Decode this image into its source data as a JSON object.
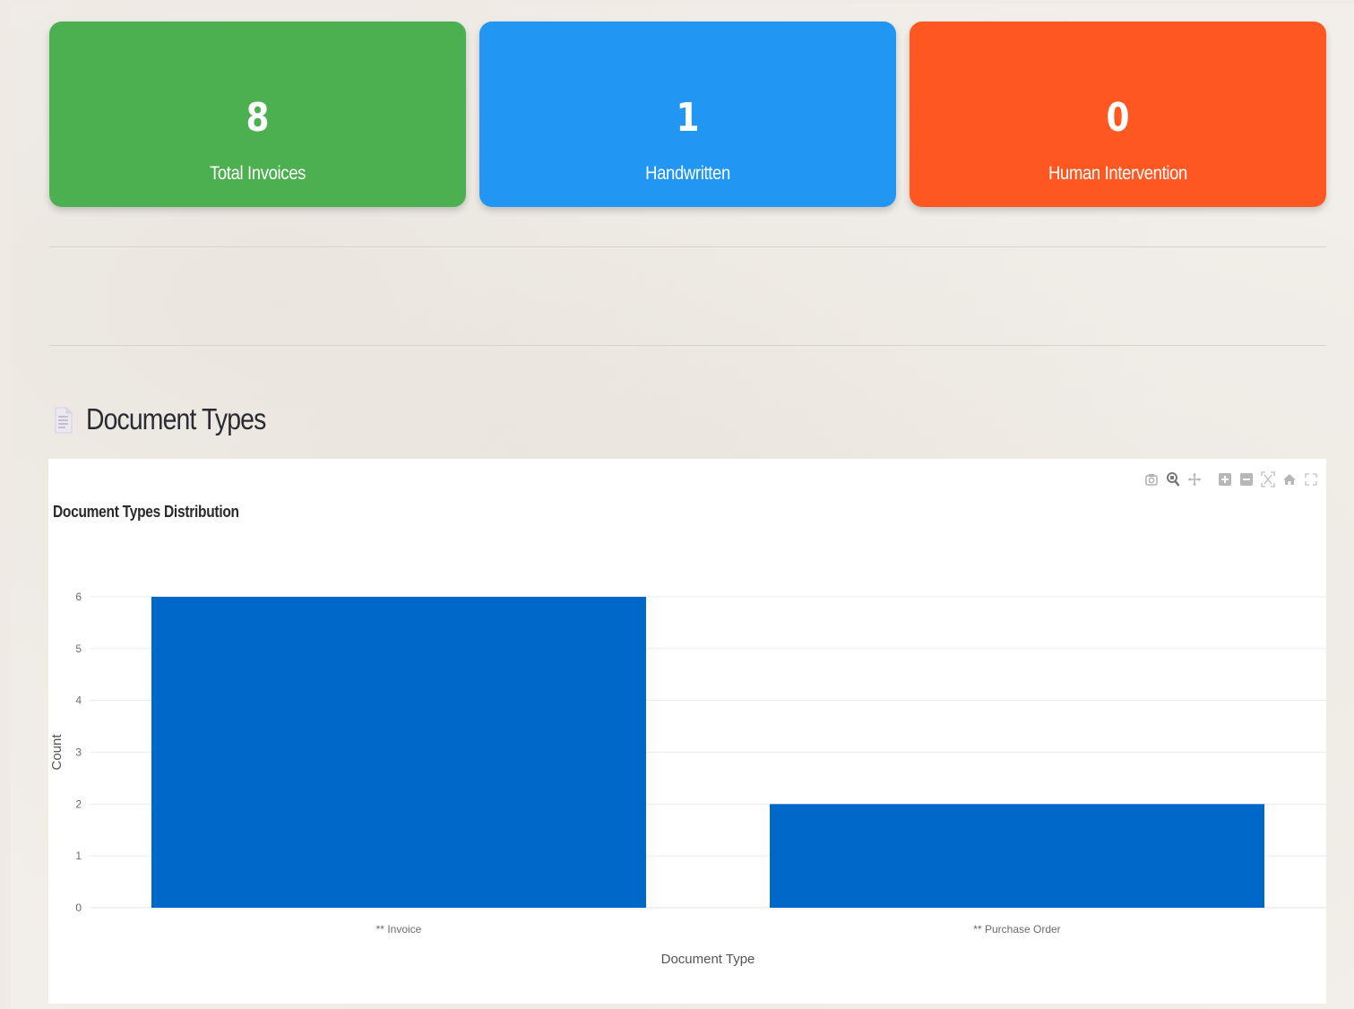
{
  "metrics": [
    {
      "value": "8",
      "label": "Total Invoices",
      "color": "#4caf50"
    },
    {
      "value": "1",
      "label": "Handwritten",
      "color": "#2196f3"
    },
    {
      "value": "0",
      "label": "Human Intervention",
      "color": "#ff5722"
    }
  ],
  "section": {
    "title": "Document Types",
    "icon": "document-icon"
  },
  "chart_toolbar": {
    "buttons": [
      "camera-icon",
      "zoom-icon",
      "pan-icon",
      "zoom-in-icon",
      "zoom-out-icon",
      "autoscale-icon",
      "reset-axes-icon",
      "fullscreen-icon"
    ]
  },
  "chart_data": {
    "type": "bar",
    "title": "Document Types Distribution",
    "categories": [
      "** Invoice",
      "** Purchase Order"
    ],
    "values": [
      6,
      2
    ],
    "xlabel": "Document Type",
    "ylabel": "Count",
    "ylim": [
      0,
      6
    ],
    "yticks": [
      0,
      1,
      2,
      3,
      4,
      5,
      6
    ],
    "bar_color": "#0068c9",
    "grid": true,
    "legend": "none"
  }
}
